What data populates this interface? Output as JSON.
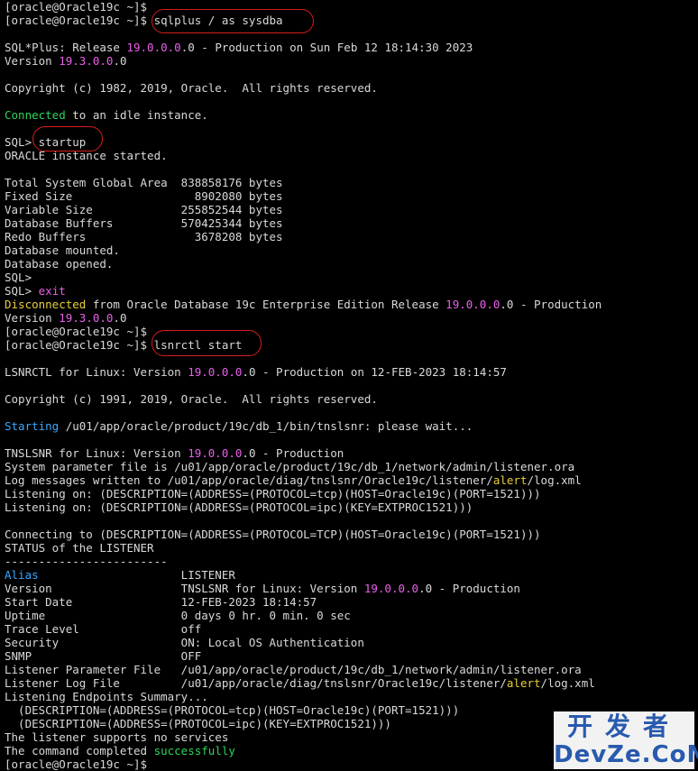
{
  "terminal": {
    "lines": [
      [
        {
          "t": "[oracle@Oracle19c ~]$"
        }
      ],
      [
        {
          "t": "[oracle@Oracle19c ~]$ sqlplus / as sysdba"
        }
      ],
      [
        {
          "t": ""
        }
      ],
      [
        {
          "t": "SQL*Plus: Release "
        },
        {
          "t": "19.0.0.0",
          "c": "pink"
        },
        {
          "t": ".0 - Production on Sun Feb 12 18:14:30 2023"
        }
      ],
      [
        {
          "t": "Version "
        },
        {
          "t": "19.3.0.0",
          "c": "pink"
        },
        {
          "t": ".0"
        }
      ],
      [
        {
          "t": ""
        }
      ],
      [
        {
          "t": "Copyright (c) 1982, 2019, Oracle.  All rights reserved."
        }
      ],
      [
        {
          "t": ""
        }
      ],
      [
        {
          "t": "Connected",
          "c": "green"
        },
        {
          "t": " to an idle instance."
        }
      ],
      [
        {
          "t": ""
        }
      ],
      [
        {
          "t": "SQL> startup"
        }
      ],
      [
        {
          "t": "ORACLE instance started."
        }
      ],
      [
        {
          "t": ""
        }
      ],
      [
        {
          "t": "Total System Global Area  838858176 bytes"
        }
      ],
      [
        {
          "t": "Fixed Size                  8902080 bytes"
        }
      ],
      [
        {
          "t": "Variable Size             255852544 bytes"
        }
      ],
      [
        {
          "t": "Database Buffers          570425344 bytes"
        }
      ],
      [
        {
          "t": "Redo Buffers                3678208 bytes"
        }
      ],
      [
        {
          "t": "Database mounted."
        }
      ],
      [
        {
          "t": "Database opened."
        }
      ],
      [
        {
          "t": "SQL>"
        }
      ],
      [
        {
          "t": "SQL> "
        },
        {
          "t": "exit",
          "c": "pink"
        }
      ],
      [
        {
          "t": "Disconnected",
          "c": "yellow"
        },
        {
          "t": " from Oracle Database 19c Enterprise Edition Release "
        },
        {
          "t": "19.0.0.0",
          "c": "pink"
        },
        {
          "t": ".0 - Production"
        }
      ],
      [
        {
          "t": "Version "
        },
        {
          "t": "19.3.0.0",
          "c": "pink"
        },
        {
          "t": ".0"
        }
      ],
      [
        {
          "t": "[oracle@Oracle19c ~]$"
        }
      ],
      [
        {
          "t": "[oracle@Oracle19c ~]$ lsnrctl start"
        }
      ],
      [
        {
          "t": ""
        }
      ],
      [
        {
          "t": "LSNRCTL for Linux: Version "
        },
        {
          "t": "19.0.0.0",
          "c": "pink"
        },
        {
          "t": ".0 - Production on 12-FEB-2023 18:14:57"
        }
      ],
      [
        {
          "t": ""
        }
      ],
      [
        {
          "t": "Copyright (c) 1991, 2019, Oracle.  All rights reserved."
        }
      ],
      [
        {
          "t": ""
        }
      ],
      [
        {
          "t": "Starting",
          "c": "cyan"
        },
        {
          "t": " /u01/app/oracle/product/19c/db_1/bin/tnslsnr: please wait..."
        }
      ],
      [
        {
          "t": ""
        }
      ],
      [
        {
          "t": "TNSLSNR for Linux: Version "
        },
        {
          "t": "19.0.0.0",
          "c": "pink"
        },
        {
          "t": ".0 - Production"
        }
      ],
      [
        {
          "t": "System parameter file is /u01/app/oracle/product/19c/db_1/network/admin/listener.ora"
        }
      ],
      [
        {
          "t": "Log messages written to /u01/app/oracle/diag/tnslsnr/Oracle19c/listener/"
        },
        {
          "t": "alert",
          "c": "yellow"
        },
        {
          "t": "/log.xml"
        }
      ],
      [
        {
          "t": "Listening on: (DESCRIPTION=(ADDRESS=(PROTOCOL=tcp)(HOST=Oracle19c)(PORT=1521)))"
        }
      ],
      [
        {
          "t": "Listening on: (DESCRIPTION=(ADDRESS=(PROTOCOL=ipc)(KEY=EXTPROC1521)))"
        }
      ],
      [
        {
          "t": ""
        }
      ],
      [
        {
          "t": "Connecting to (DESCRIPTION=(ADDRESS=(PROTOCOL=TCP)(HOST=Oracle19c)(PORT=1521)))"
        }
      ],
      [
        {
          "t": "STATUS of the LISTENER"
        }
      ],
      [
        {
          "t": "------------------------"
        }
      ],
      [
        {
          "t": "Alias",
          "c": "cyan"
        },
        {
          "t": "                     LISTENER"
        }
      ],
      [
        {
          "t": "Version                   TNSLSNR for Linux: Version "
        },
        {
          "t": "19.0.0.0",
          "c": "pink"
        },
        {
          "t": ".0 - Production"
        }
      ],
      [
        {
          "t": "Start Date                12-FEB-2023 18:14:57"
        }
      ],
      [
        {
          "t": "Uptime                    0 days 0 hr. 0 min. 0 sec"
        }
      ],
      [
        {
          "t": "Trace Level               off"
        }
      ],
      [
        {
          "t": "Security                  ON: Local OS Authentication"
        }
      ],
      [
        {
          "t": "SNMP                      OFF"
        }
      ],
      [
        {
          "t": "Listener Parameter File   /u01/app/oracle/product/19c/db_1/network/admin/listener.ora"
        }
      ],
      [
        {
          "t": "Listener Log File         /u01/app/oracle/diag/tnslsnr/Oracle19c/listener/"
        },
        {
          "t": "alert",
          "c": "yellow"
        },
        {
          "t": "/log.xml"
        }
      ],
      [
        {
          "t": "Listening Endpoints Summary..."
        }
      ],
      [
        {
          "t": "  (DESCRIPTION=(ADDRESS=(PROTOCOL=tcp)(HOST=Oracle19c)(PORT=1521)))"
        }
      ],
      [
        {
          "t": "  (DESCRIPTION=(ADDRESS=(PROTOCOL=ipc)(KEY=EXTPROC1521)))"
        }
      ],
      [
        {
          "t": "The listener supports no services"
        }
      ],
      [
        {
          "t": "The command completed "
        },
        {
          "t": "successfully",
          "c": "green"
        }
      ],
      [
        {
          "t": "[oracle@Oracle19c ~]$"
        }
      ]
    ]
  },
  "watermark": {
    "cn": "开发者",
    "en": "DevZe.CoM"
  },
  "colors": {
    "background": "#000000",
    "text": "#d9d9d9",
    "pink": "#e860e8",
    "green": "#2fd35a",
    "cyan": "#3aa7ff",
    "yellow": "#e8cf3a",
    "annotation": "#d81d1d",
    "watermark": "#2b5fb8"
  }
}
